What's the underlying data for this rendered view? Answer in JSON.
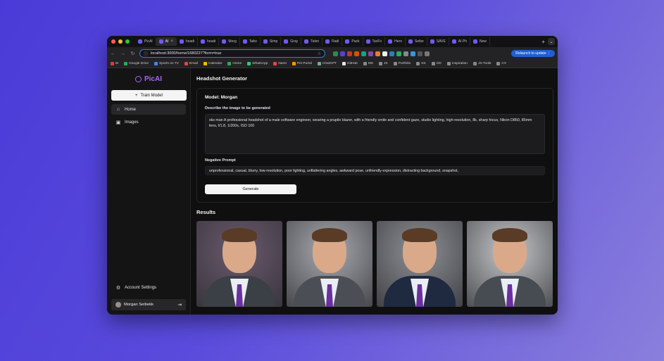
{
  "browser": {
    "tabs": [
      {
        "label": "PicAI",
        "active": false
      },
      {
        "label": "AI",
        "active": true
      },
      {
        "label": "headi",
        "active": false
      },
      {
        "label": "headi",
        "active": false
      },
      {
        "label": "Morg",
        "active": false
      },
      {
        "label": "Tailw",
        "active": false
      },
      {
        "label": "Simp",
        "active": false
      },
      {
        "label": "Gray",
        "active": false
      },
      {
        "label": "Talen",
        "active": false
      },
      {
        "label": "Radi",
        "active": false
      },
      {
        "label": "Pack",
        "active": false
      },
      {
        "label": "TaxFo",
        "active": false
      },
      {
        "label": "Hero",
        "active": false
      },
      {
        "label": "Seibe",
        "active": false
      },
      {
        "label": "SAVE",
        "active": false
      },
      {
        "label": "AI Ph",
        "active": false
      },
      {
        "label": "New",
        "active": false
      }
    ],
    "new_tab": "+",
    "tab_close": "×",
    "tab_menu": "⌄",
    "url": "localhost:3000/home/1680227?form=true",
    "relaunch_label": "Relaunch to update",
    "relaunch_more": "⋮",
    "nav_icons": [
      "←",
      "→",
      "↻"
    ],
    "site_info_icon": "ⓘ",
    "bookmark_icon": "☆",
    "bookmarks": [
      "M",
      "Google Drive",
      "Sports on TV",
      "Email",
      "Calendar",
      "Home",
      "WhatsApp",
      "Namt",
      "Pet Portal",
      "ChatGPT",
      "GitHub",
      "MS",
      "JS",
      "Portfolio",
      "SS",
      "OD",
      "Inspiration",
      "JS-Tools",
      "CV"
    ],
    "colors": {
      "accent": "#1f5fd1",
      "red": "#ff5f57",
      "yellow": "#febc2e",
      "green": "#28c840"
    }
  },
  "sidebar": {
    "logo": "PicAI",
    "train_button": "Train Model",
    "train_icon": "+",
    "nav": [
      {
        "label": "Home",
        "icon": "home-icon",
        "glyph": "⌂",
        "active": true
      },
      {
        "label": "Images",
        "icon": "image-icon",
        "glyph": "▣",
        "active": false
      }
    ],
    "account_settings": "Account Settings",
    "settings_glyph": "⚙",
    "user_name": "Morgan Seibekk",
    "logout_glyph": "⇥",
    "brand_color": "#a86af5"
  },
  "main": {
    "title": "Headshot Generator",
    "model_label": "Model: Morgan",
    "prompt_label": "Describe the image to be generated",
    "prompt_value": "sks man A professional headshot of a male software engineer, wearing a prupile blazer, with a friendly smile and confident gaze, studio lighting, high-resolution, 8k, sharp focus, Nikon D850, 85mm lens, f/1.8, 1/200s, ISO 100",
    "negative_label": "Negative Prompt",
    "negative_value": "unprofessional, casual, blurry, low-resolution, poor lighting, unflattering angles, awkward pose, unfriendly expression, distracting background, snapshot,",
    "generate_button": "Generate",
    "results_title": "Results",
    "results": [
      {
        "bg": "#6b5a6e",
        "suit": "#3b3f46"
      },
      {
        "bg": "#a8abb0",
        "suit": "#4b4f55"
      },
      {
        "bg": "#8e9196",
        "suit": "#1f2940"
      },
      {
        "bg": "#c7c9cc",
        "suit": "#474c53"
      }
    ]
  }
}
